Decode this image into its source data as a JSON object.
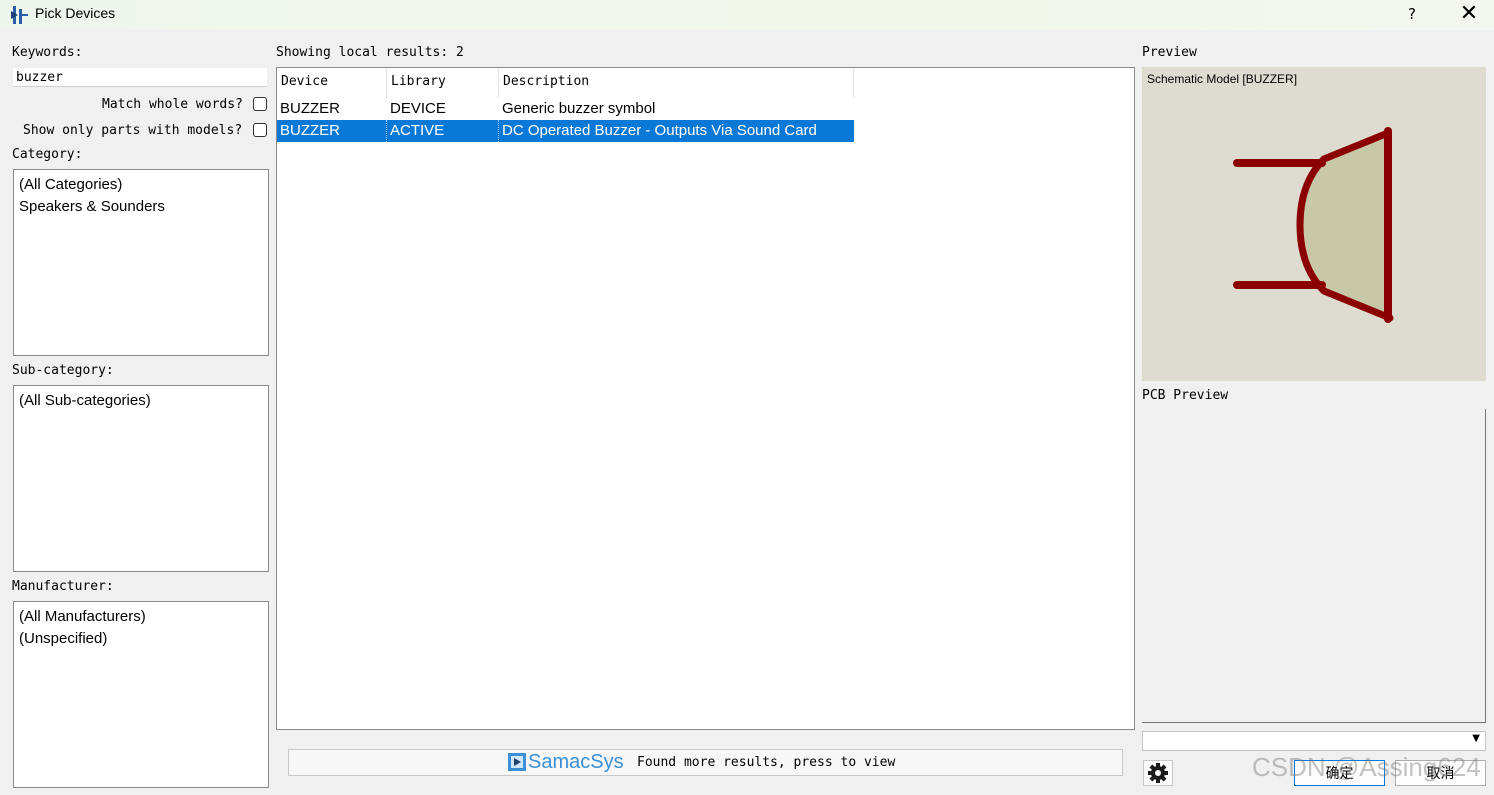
{
  "window": {
    "title": "Pick Devices",
    "help_label": "?",
    "close_label": "✕"
  },
  "left": {
    "keywords_label": "Keywords:",
    "keywords_value": "buzzer",
    "match_whole_words_label": "Match whole words?",
    "show_only_models_label": "Show only parts with models?",
    "category_label": "Category:",
    "categories": [
      "(All Categories)",
      "Speakers & Sounders"
    ],
    "subcategory_label": "Sub-category:",
    "subcategories": [
      "(All Sub-categories)"
    ],
    "manufacturer_label": "Manufacturer:",
    "manufacturers": [
      "(All Manufacturers)",
      "(Unspecified)"
    ]
  },
  "results": {
    "summary": "Showing local results: 2",
    "columns": [
      "Device",
      "Library",
      "Description"
    ],
    "rows": [
      {
        "device": "BUZZER",
        "library": "DEVICE",
        "description": "Generic buzzer symbol",
        "selected": false
      },
      {
        "device": "BUZZER",
        "library": "ACTIVE",
        "description": "DC Operated Buzzer - Outputs Via Sound Card",
        "selected": true
      }
    ]
  },
  "banner": {
    "brand": "SamacSys",
    "message": "Found more results, press to view"
  },
  "preview": {
    "label": "Preview",
    "schematic_caption": "Schematic Model [BUZZER]",
    "pcb_label": "PCB Preview",
    "package_value": "",
    "symbol_color": "#8b0000",
    "symbol_fill": "#c8c8a8"
  },
  "buttons": {
    "ok": "确定",
    "cancel": "取消",
    "settings_icon": "gear-icon"
  },
  "watermark": "CSDN @Assing624"
}
